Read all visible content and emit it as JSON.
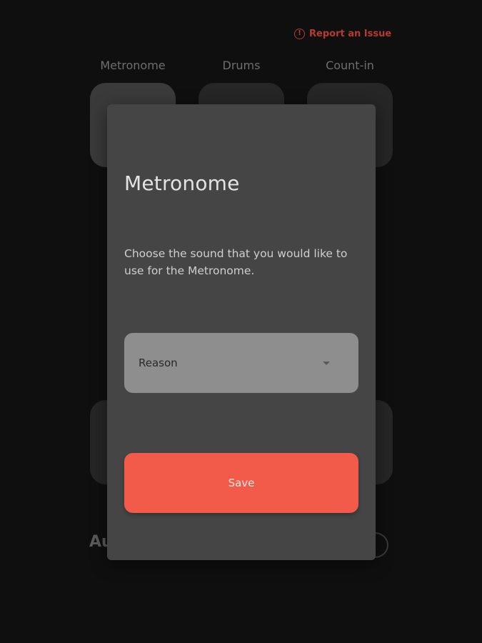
{
  "header": {
    "report_label": "Report an Issue",
    "report_icon": "alert-circle-icon",
    "report_color": "#b53a30"
  },
  "tabs": [
    {
      "label": "Metronome"
    },
    {
      "label": "Drums"
    },
    {
      "label": "Count-in"
    }
  ],
  "background": {
    "partial_text": "Au"
  },
  "modal": {
    "title": "Metronome",
    "description": "Choose the sound that you would like to use for the Metronome.",
    "select": {
      "value": "Reason",
      "icon": "chevron-down-icon"
    },
    "save_label": "Save",
    "save_color": "#f25b4a"
  }
}
